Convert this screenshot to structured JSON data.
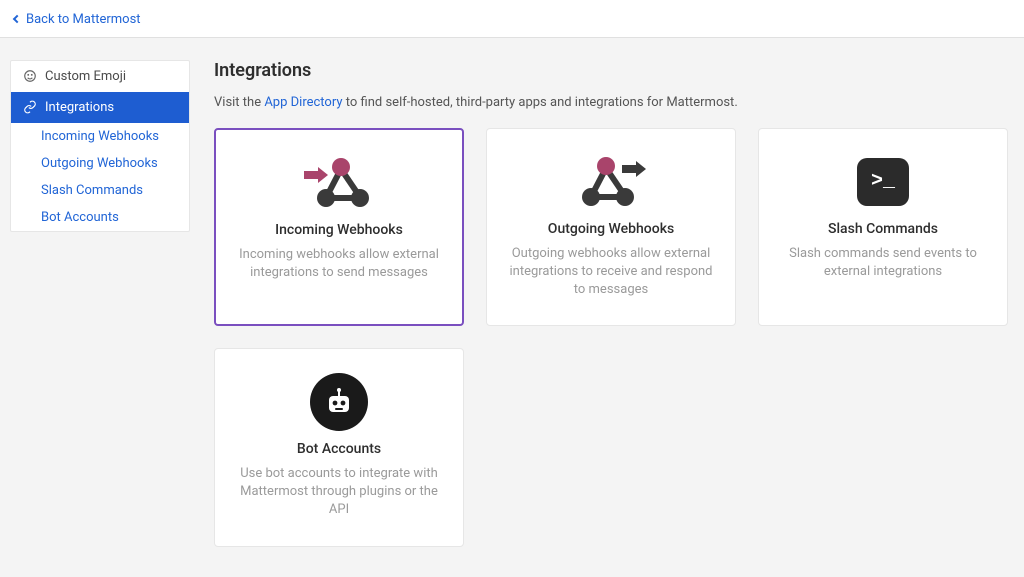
{
  "header": {
    "back_label": "Back to Mattermost"
  },
  "sidebar": {
    "custom_emoji": "Custom Emoji",
    "integrations": "Integrations",
    "items": [
      "Incoming Webhooks",
      "Outgoing Webhooks",
      "Slash Commands",
      "Bot Accounts"
    ]
  },
  "main": {
    "title": "Integrations",
    "intro_pre": "Visit the ",
    "intro_link": "App Directory",
    "intro_post": " to find self-hosted, third-party apps and integrations for Mattermost."
  },
  "cards": {
    "incoming": {
      "title": "Incoming Webhooks",
      "desc": "Incoming webhooks allow external integrations to send messages"
    },
    "outgoing": {
      "title": "Outgoing Webhooks",
      "desc": "Outgoing webhooks allow external integrations to receive and respond to messages"
    },
    "slash": {
      "title": "Slash Commands",
      "desc": "Slash commands send events to external integrations",
      "glyph": ">_"
    },
    "bot": {
      "title": "Bot Accounts",
      "desc": "Use bot accounts to integrate with Mattermost through plugins or the API"
    }
  }
}
